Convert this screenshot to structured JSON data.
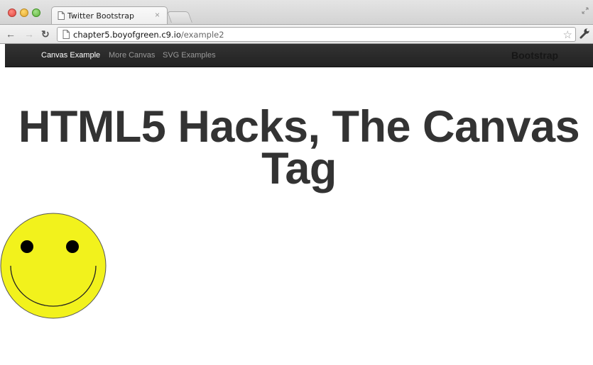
{
  "browser": {
    "tab_title": "Twitter Bootstrap",
    "tab_close": "×",
    "url_host": "chapter5.boyofgreen.c9.io",
    "url_path": "/example2"
  },
  "navbar": {
    "links": [
      "Canvas Example",
      "More Canvas",
      "SVG Examples"
    ],
    "active_index": 0,
    "brand": "Bootstrap"
  },
  "main": {
    "headline_line1": "HTML5 Hacks, The Canvas",
    "headline_line2": "Tag"
  },
  "canvas": {
    "smiley_fill": "#f2f21c",
    "smiley_stroke": "#555555"
  },
  "colors": {
    "navbar_bg": "#222222",
    "headline": "#333333"
  }
}
